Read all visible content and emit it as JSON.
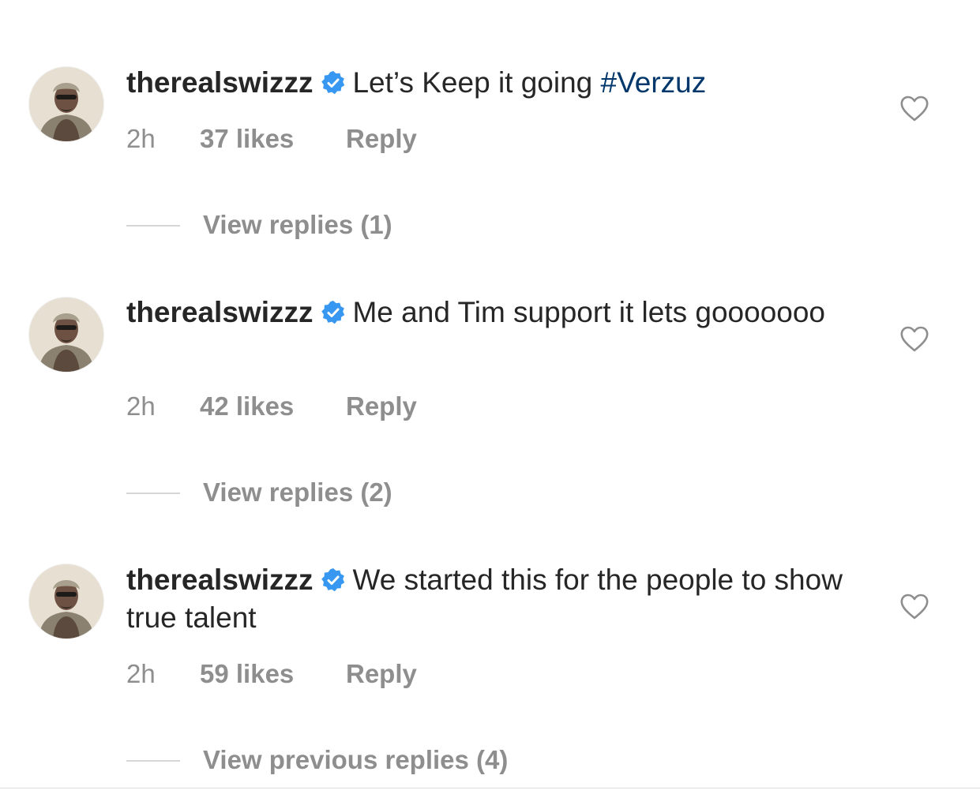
{
  "comments": [
    {
      "username": "therealswizzz",
      "text": "Let’s Keep it going ",
      "hashtag": "#Verzuz",
      "time": "2h",
      "likes": "37 likes",
      "reply": "Reply",
      "view_replies": "View replies (1)"
    },
    {
      "username": "therealswizzz",
      "text": "Me and Tim support it lets gooooooo",
      "hashtag": "",
      "time": "2h",
      "likes": "42 likes",
      "reply": "Reply",
      "view_replies": "View replies (2)"
    },
    {
      "username": "therealswizzz",
      "text": "We started this for the people to show true talent",
      "hashtag": "",
      "time": "2h",
      "likes": "59 likes",
      "reply": "Reply",
      "view_replies": "View previous replies (4)"
    }
  ],
  "icons": {
    "verified": "verified-badge-icon",
    "like": "heart-icon"
  },
  "colors": {
    "text": "#262626",
    "muted": "#8e8e8e",
    "hashtag": "#00376b",
    "verified": "#3897f0"
  }
}
